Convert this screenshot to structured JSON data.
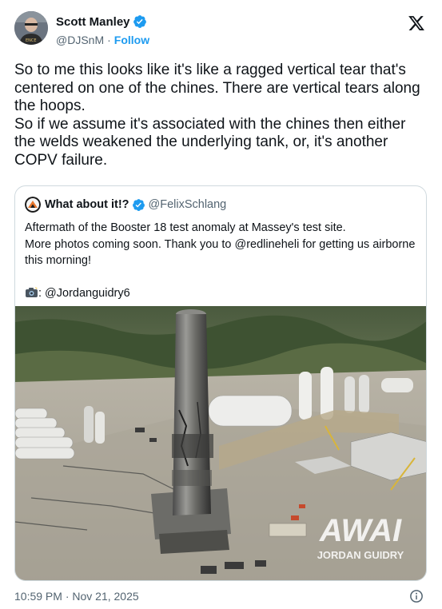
{
  "author": {
    "name": "Scott Manley",
    "handle": "@DJSnM",
    "separator": "·",
    "follow_label": "Follow"
  },
  "tweet": {
    "text": "So to me this looks like it's like a ragged vertical tear that's centered on one of the chines. There are vertical tears along the hoops.\nSo if we assume it's associated with the chines then either the welds weakened the underlying tank, or, it's another COPV failure."
  },
  "quote": {
    "name": "What about it!?",
    "handle": "@FelixSchlang",
    "text": "Aftermath of the Booster 18 test anomaly at Massey's test site.\nMore photos coming soon. Thank you to @redlineheli for getting us airborne this morning!",
    "credit": ": @Jordanguidry6",
    "image": {
      "watermark_logo": "AWAI",
      "watermark_text": "JORDAN GUIDRY"
    }
  },
  "footer": {
    "timestamp": "10:59 PM · Nov 21, 2025"
  },
  "colors": {
    "accent": "#1d9bf0",
    "text": "#0f1419",
    "muted": "#536471",
    "border": "#cfd9de"
  }
}
